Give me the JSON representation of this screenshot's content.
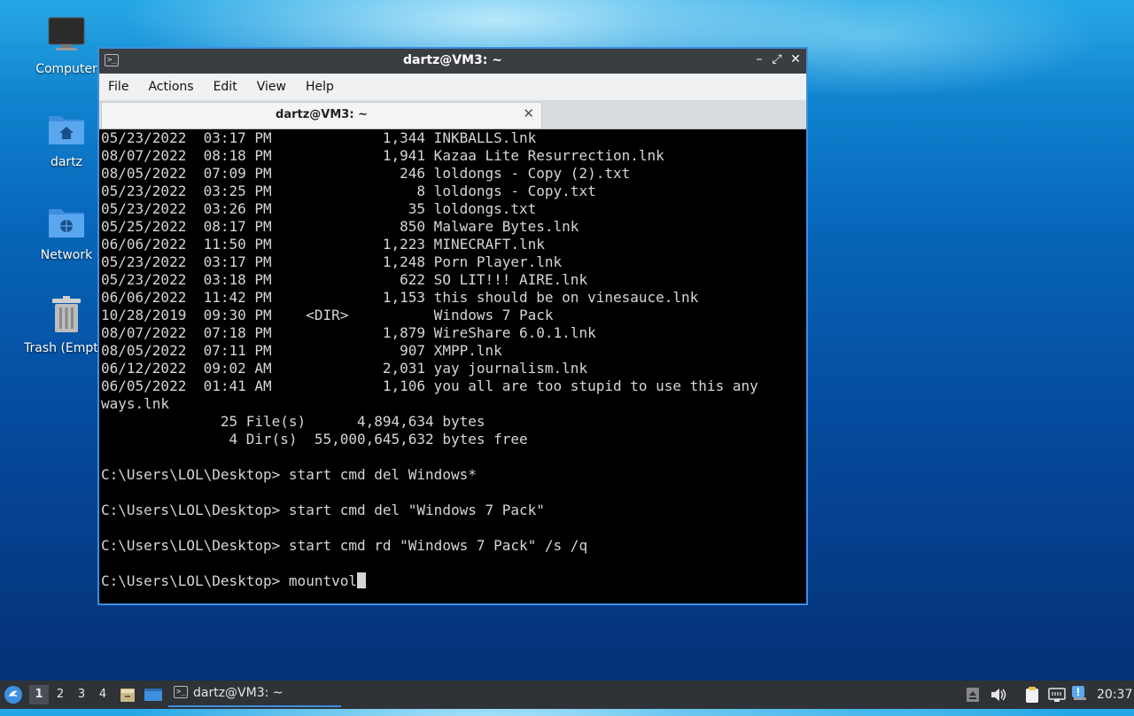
{
  "desktop": {
    "icons": [
      {
        "label": "Computer",
        "icon": "monitor-icon"
      },
      {
        "label": "dartz",
        "icon": "home-folder-icon"
      },
      {
        "label": "Network",
        "icon": "network-folder-icon"
      },
      {
        "label": "Trash (Empty)",
        "icon": "trash-icon"
      }
    ]
  },
  "window": {
    "title": "dartz@VM3: ~",
    "controls": {
      "minimize": "–",
      "maximize": "⤢",
      "close": "✕"
    },
    "menu": [
      "File",
      "Actions",
      "Edit",
      "View",
      "Help"
    ],
    "tab": {
      "title": "dartz@VM3: ~",
      "close": "✕"
    }
  },
  "terminal": {
    "lines": [
      "05/23/2022  03:17 PM             1,344 INKBALLS.lnk",
      "08/07/2022  08:18 PM             1,941 Kazaa Lite Resurrection.lnk",
      "08/05/2022  07:09 PM               246 loldongs - Copy (2).txt",
      "05/23/2022  03:25 PM                 8 loldongs - Copy.txt",
      "05/23/2022  03:26 PM                35 loldongs.txt",
      "05/25/2022  08:17 PM               850 Malware Bytes.lnk",
      "06/06/2022  11:50 PM             1,223 MINECRAFT.lnk",
      "05/23/2022  03:17 PM             1,248 Porn Player.lnk",
      "05/23/2022  03:18 PM               622 SO LIT!!! AIRE.lnk",
      "06/06/2022  11:42 PM             1,153 this should be on vinesauce.lnk",
      "10/28/2019  09:30 PM    <DIR>          Windows 7 Pack",
      "08/07/2022  07:18 PM             1,879 WireShare 6.0.1.lnk",
      "08/05/2022  07:11 PM               907 XMPP.lnk",
      "06/12/2022  09:02 AM             2,031 yay journalism.lnk",
      "06/05/2022  01:41 AM             1,106 you all are too stupid to use this any",
      "ways.lnk",
      "              25 File(s)      4,894,634 bytes",
      "               4 Dir(s)  55,000,645,632 bytes free",
      "",
      "C:\\Users\\LOL\\Desktop> start cmd del Windows*",
      "",
      "C:\\Users\\LOL\\Desktop> start cmd del \"Windows 7 Pack\"",
      "",
      "C:\\Users\\LOL\\Desktop> start cmd rd \"Windows 7 Pack\" /s /q",
      ""
    ],
    "prompt": "C:\\Users\\LOL\\Desktop> ",
    "current_input": "mountvol"
  },
  "taskbar": {
    "workspaces": [
      "1",
      "2",
      "3",
      "4"
    ],
    "active_workspace": "1",
    "task": {
      "label": "dartz@VM3: ~"
    },
    "clock": "20:37"
  }
}
